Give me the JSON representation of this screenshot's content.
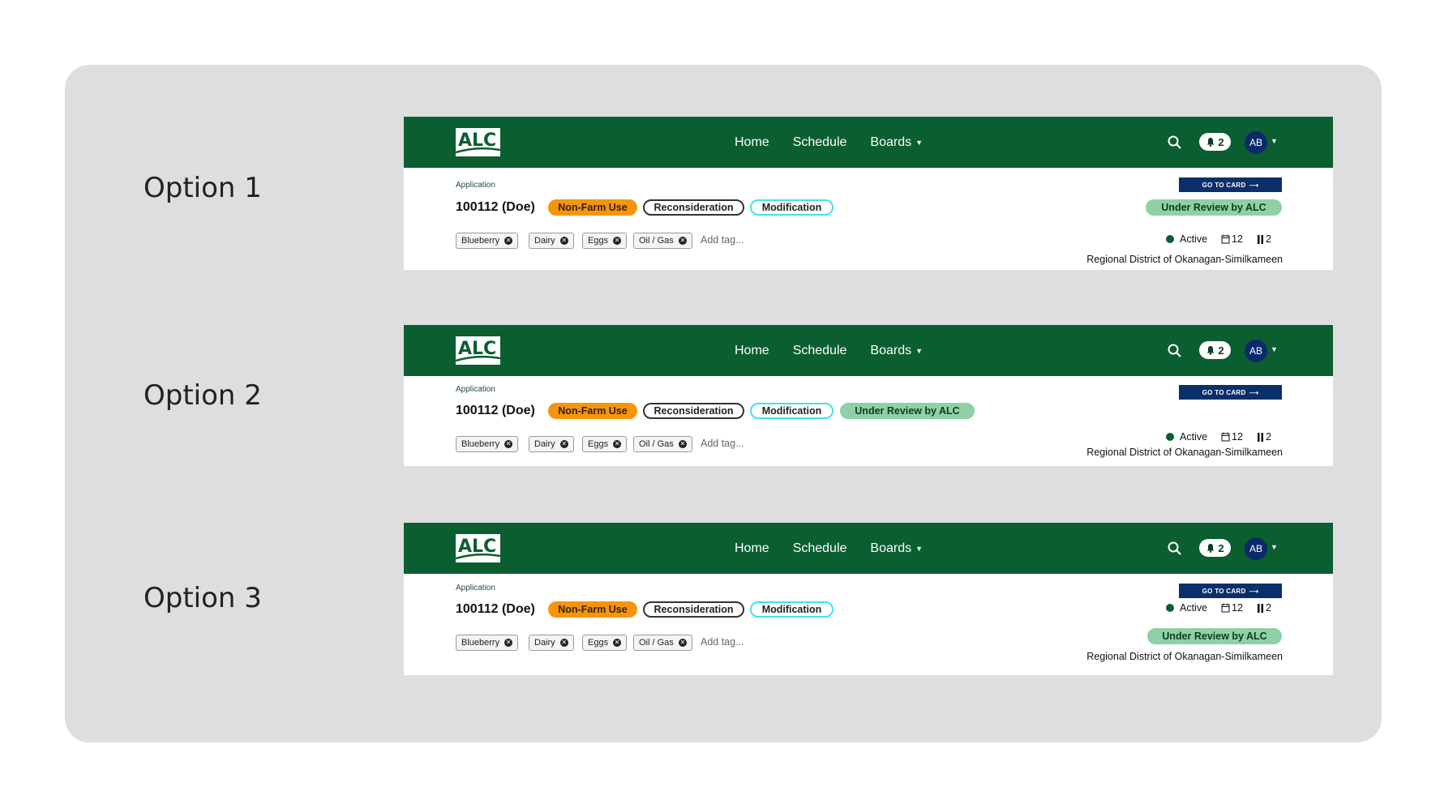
{
  "options": [
    {
      "label": "Option 1",
      "nav": {
        "logo": "ALC",
        "links": [
          "Home",
          "Schedule",
          "Boards"
        ],
        "notifications": "2",
        "avatar": "AB"
      },
      "card": {
        "type": "Application",
        "id": "100112 (Doe)",
        "chips": [
          "Non-Farm Use",
          "Reconsideration",
          "Modification"
        ],
        "status": "Under Review by ALC",
        "tags": [
          "Blueberry",
          "Dairy",
          "Eggs",
          "Oil / Gas"
        ],
        "add_tag_placeholder": "Add tag...",
        "goto_label": "GO TO CARD",
        "state": "Active",
        "calendar_count": "12",
        "pause_count": "2",
        "region": "Regional District of Okanagan-Similkameen"
      }
    },
    {
      "label": "Option 2",
      "nav": {
        "logo": "ALC",
        "links": [
          "Home",
          "Schedule",
          "Boards"
        ],
        "notifications": "2",
        "avatar": "AB"
      },
      "card": {
        "type": "Application",
        "id": "100112 (Doe)",
        "chips": [
          "Non-Farm Use",
          "Reconsideration",
          "Modification"
        ],
        "status": "Under Review by ALC",
        "tags": [
          "Blueberry",
          "Dairy",
          "Eggs",
          "Oil / Gas"
        ],
        "add_tag_placeholder": "Add tag...",
        "goto_label": "GO TO CARD",
        "state": "Active",
        "calendar_count": "12",
        "pause_count": "2",
        "region": "Regional District of Okanagan-Similkameen"
      }
    },
    {
      "label": "Option 3",
      "nav": {
        "logo": "ALC",
        "links": [
          "Home",
          "Schedule",
          "Boards"
        ],
        "notifications": "2",
        "avatar": "AB"
      },
      "card": {
        "type": "Application",
        "id": "100112 (Doe)",
        "chips": [
          "Non-Farm Use",
          "Reconsideration",
          "Modification"
        ],
        "status": "Under Review by ALC",
        "tags": [
          "Blueberry",
          "Dairy",
          "Eggs",
          "Oil / Gas"
        ],
        "add_tag_placeholder": "Add tag...",
        "goto_label": "GO TO CARD",
        "state": "Active",
        "calendar_count": "12",
        "pause_count": "2",
        "region": "Regional District of Okanagan-Similkameen"
      }
    }
  ],
  "colors": {
    "nav_green": "#0b5e30",
    "status_green": "#8fd0a6",
    "non_farm_orange": "#f5940f",
    "modification_cyan": "#3ee3ea",
    "navy": "#0b2f6b"
  }
}
